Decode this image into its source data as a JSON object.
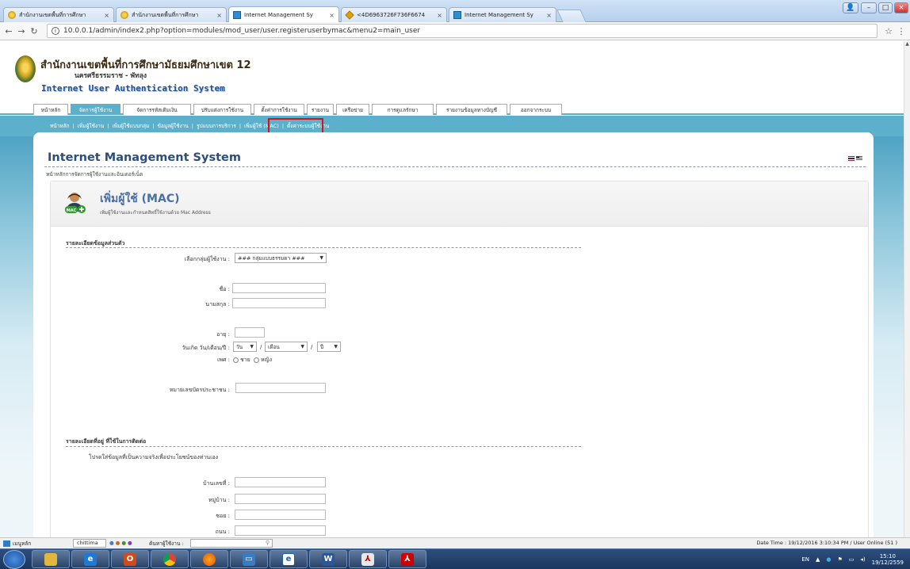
{
  "browser": {
    "tabs": [
      {
        "title": "สำนักงานเขตพื้นที่การศึกษา",
        "icon": "seal-icon"
      },
      {
        "title": "สำนักงานเขตพื้นที่การศึกษา",
        "icon": "seal-icon"
      },
      {
        "title": "Internet Management Sy",
        "icon": "page-icon"
      },
      {
        "title": "<4D6963726F736F6674",
        "icon": "image-icon"
      },
      {
        "title": "Internet Management Sy",
        "icon": "page-icon"
      }
    ],
    "url": "10.0.0.1/admin/index2.php?option=modules/mod_user/user.registeruserbymac&menu2=main_user",
    "info_icon": "i"
  },
  "header": {
    "org_name": "สำนักงานเขตพื้นที่การศึกษามัธยมศึกษาเขต 12",
    "region": "นครศรีธรรมราช - พัทลุง",
    "system_name": "Internet User Authentication  System"
  },
  "menu": {
    "tabs": [
      "หน้าหลัก",
      "จัดการผู้ใช้งาน",
      "จัดการรหัสเติมเงิน",
      "ปรับแต่งการใช้งาน",
      "ตั้งค่าการใช้งาน",
      "รายงาน",
      "เครือข่าย",
      "การดูแลรักษา",
      "รายงานข้อมูลทางบัญชี",
      "ออกจากระบบ"
    ],
    "sub_items": [
      "หน้าหลัก",
      "เพิ่มผู้ใช้งาน",
      "เพิ่มผู้ใช้แบบกลุ่ม",
      "ข้อมูลผู้ใช้งาน",
      "รูปแบบการบริการ",
      "เพิ่มผู้ใช้ (MAC)",
      "ตั้งค่าระบบผู้ใช้งาน"
    ]
  },
  "panel": {
    "title": "Internet Management System",
    "subtitle": "หน้าหลักการจัดการผู้ใช้งานและอินเตอร์เน็ต",
    "form_title": "เพิ่มผู้ใช้ (MAC)",
    "form_desc": "เพิ่มผู้ใช้งานและกำหนดสิทธิ์ใช้งานด้วย Mac Address"
  },
  "form": {
    "section1": "รายละเอียดข้อมูลส่วนตัว",
    "group_label": "เลือกกลุ่มผู้ใช้งาน :",
    "group_value": "### กลุ่มแบบธรรมดา ###",
    "first_name": "ชื่อ :",
    "last_name": "นามสกุล :",
    "age": "อายุ :",
    "birthdate": "วันเกิด วัน/เดือน/ปี :",
    "day": "วัน",
    "month": "เดือน",
    "year": "ปี",
    "slash": "/",
    "gender": "เพศ :",
    "male": "ชาย",
    "female": "หญิง",
    "id_card": "หมายเลขบัตรประชาชน :",
    "section2": "รายละเอียดที่อยู่ ที่ใช้ในการติดต่อ",
    "note": "โปรดใส่ข้อมูลที่เป็นความจริงเพื่อประโยชน์ของท่านเอง",
    "house_no": "บ้านเลขที่ :",
    "village": "หมู่บ้าน :",
    "soi": "ซอย :",
    "road": "ถนน :"
  },
  "statusbar": {
    "menu": "เมนูหลัก",
    "user": "chittima",
    "search_label": "ค้นหาผู้ใช้งาน :",
    "datetime": "Date Time : 19/12/2016 3:10:34 PM  / User Online (51 )"
  },
  "taskbar": {
    "lang": "EN",
    "time": "15:10",
    "date": "19/12/2559"
  },
  "colors": {
    "accent": "#5cb0cc",
    "title": "#2d4d7a",
    "highlight": "#e01010"
  }
}
